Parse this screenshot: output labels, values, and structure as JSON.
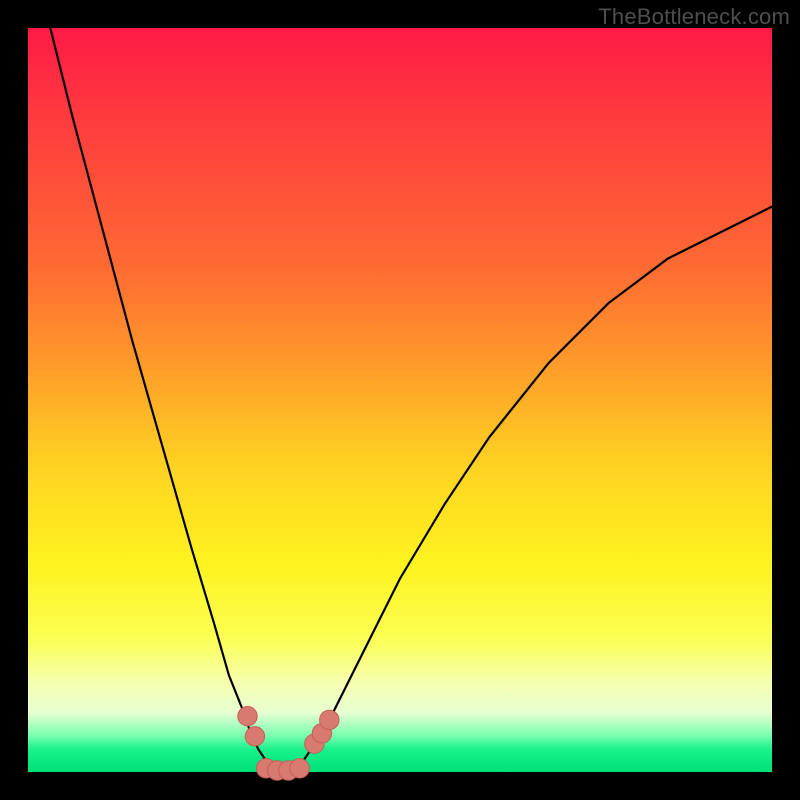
{
  "watermark": "TheBottleneck.com",
  "colors": {
    "frame": "#000000",
    "curve": "#000000",
    "marker_fill": "#d97a72",
    "marker_stroke": "#c55e56"
  },
  "chart_data": {
    "type": "line",
    "title": "",
    "xlabel": "",
    "ylabel": "",
    "xlim": [
      0,
      100
    ],
    "ylim": [
      0,
      100
    ],
    "grid": false,
    "series": [
      {
        "name": "bottleneck-curve",
        "x": [
          3,
          6,
          10,
          14,
          18,
          22,
          25,
          27,
          29,
          30,
          31,
          32,
          33,
          34,
          35,
          36,
          37,
          38,
          40,
          42,
          45,
          50,
          56,
          62,
          70,
          78,
          86,
          94,
          100
        ],
        "y": [
          100,
          88,
          73,
          58,
          44,
          30,
          20,
          13,
          8,
          5,
          3,
          1.5,
          0.5,
          0,
          0,
          0.5,
          1.5,
          3,
          6,
          10,
          16,
          26,
          36,
          45,
          55,
          63,
          69,
          73,
          76
        ]
      }
    ],
    "markers": [
      {
        "name": "left-upper",
        "x": 29.5,
        "y": 7.5,
        "r": 1.3
      },
      {
        "name": "left-lower",
        "x": 30.5,
        "y": 4.8,
        "r": 1.3
      },
      {
        "name": "valley-1",
        "x": 32.0,
        "y": 0.5,
        "r": 1.3
      },
      {
        "name": "valley-2",
        "x": 33.5,
        "y": 0.2,
        "r": 1.3
      },
      {
        "name": "valley-3",
        "x": 35.0,
        "y": 0.2,
        "r": 1.3
      },
      {
        "name": "valley-4",
        "x": 36.5,
        "y": 0.5,
        "r": 1.3
      },
      {
        "name": "right-1",
        "x": 38.5,
        "y": 3.8,
        "r": 1.3
      },
      {
        "name": "right-2",
        "x": 39.5,
        "y": 5.2,
        "r": 1.3
      },
      {
        "name": "right-3",
        "x": 40.5,
        "y": 7.0,
        "r": 1.3
      }
    ]
  }
}
